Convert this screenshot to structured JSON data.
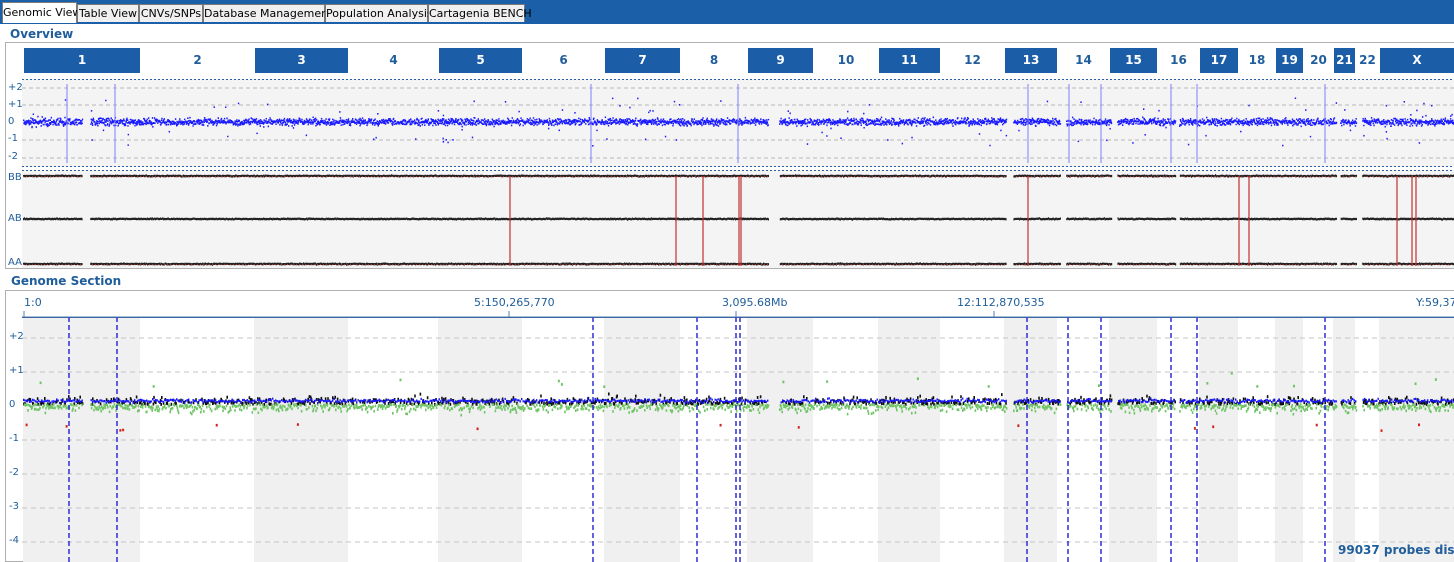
{
  "tabs": [
    {
      "label": "Genomic View",
      "active": true
    },
    {
      "label": "Table View",
      "active": false
    },
    {
      "label": "CNVs/SNPs",
      "active": false
    },
    {
      "label": "Database Management",
      "active": false
    },
    {
      "label": "Population Analysis",
      "active": false
    },
    {
      "label": "Cartagenia BENCH",
      "active": false
    }
  ],
  "overview": {
    "title": "Overview",
    "chromosomes": [
      "1",
      "2",
      "3",
      "4",
      "5",
      "6",
      "7",
      "8",
      "9",
      "10",
      "11",
      "12",
      "13",
      "14",
      "15",
      "16",
      "17",
      "18",
      "19",
      "20",
      "21",
      "22",
      "X"
    ],
    "logratio_labels": [
      "+2",
      "+1",
      "0",
      "-1",
      "-2"
    ],
    "baf_labels": [
      "BB",
      "AB",
      "AA"
    ]
  },
  "genome_section": {
    "title": "Genome Section",
    "axis_labels": [
      "1:0",
      "5:150,265,770",
      "3,095.68Mb",
      "12:112,870,535",
      "Y:59,37"
    ],
    "y_labels": [
      "+2",
      "+1",
      "0",
      "-1",
      "-2",
      "-3",
      "-4"
    ],
    "probes_displayed": "99037 probes displa"
  },
  "colors": {
    "accent": "#1b5ea7",
    "probe_blue": "#0000ff",
    "probe_green": "#7ac870",
    "probe_red": "#cc2020",
    "baf_line": "#c03030"
  }
}
